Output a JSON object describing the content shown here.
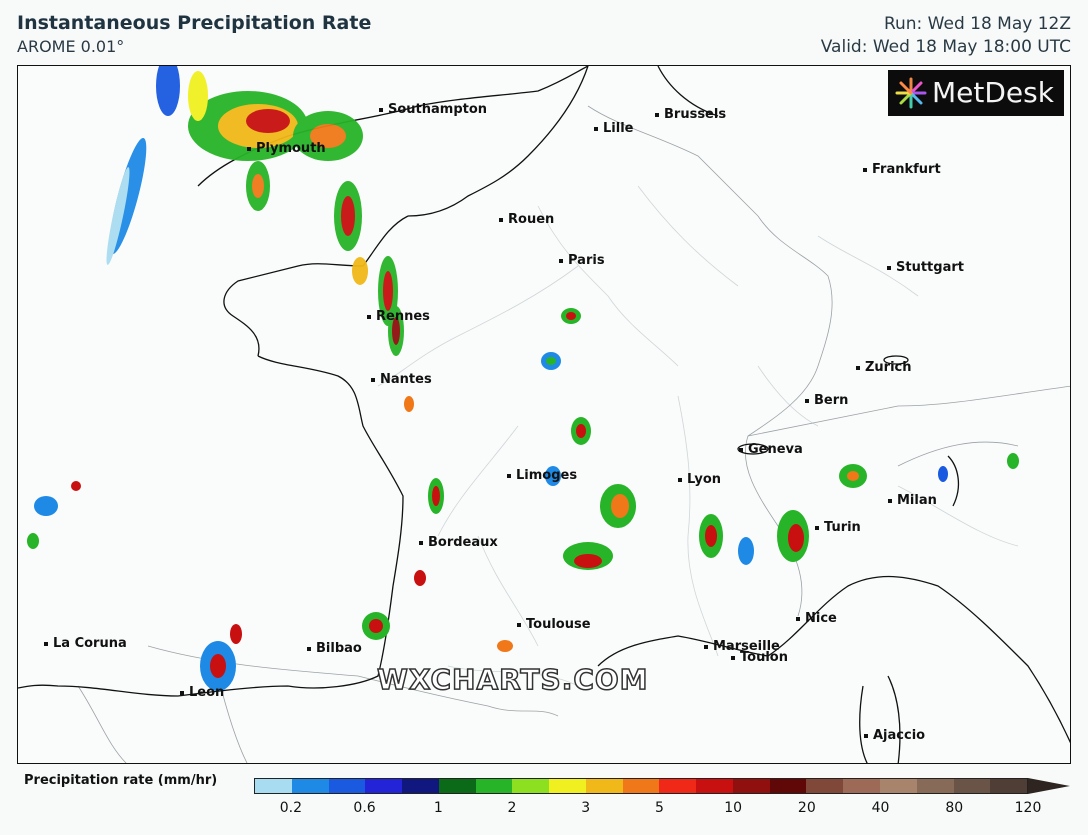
{
  "header": {
    "title": "Instantaneous Precipitation Rate",
    "model": "AROME 0.01°",
    "run": "Run: Wed 18 May 12Z",
    "valid": "Valid: Wed 18 May 18:00 UTC"
  },
  "logo": {
    "text": "MetDesk"
  },
  "watermark": "WXCHARTS.COM",
  "cities": [
    {
      "name": "Southampton"
    },
    {
      "name": "Brussels"
    },
    {
      "name": "Lille"
    },
    {
      "name": "Plymouth"
    },
    {
      "name": "Frankfurt"
    },
    {
      "name": "Rouen"
    },
    {
      "name": "Paris"
    },
    {
      "name": "Stuttgart"
    },
    {
      "name": "Rennes"
    },
    {
      "name": "Zurich"
    },
    {
      "name": "Nantes"
    },
    {
      "name": "Bern"
    },
    {
      "name": "Geneva"
    },
    {
      "name": "Limoges"
    },
    {
      "name": "Lyon"
    },
    {
      "name": "Milan"
    },
    {
      "name": "Turin"
    },
    {
      "name": "Bordeaux"
    },
    {
      "name": "Toulouse"
    },
    {
      "name": "Nice"
    },
    {
      "name": "La Coruna"
    },
    {
      "name": "Bilbao"
    },
    {
      "name": "Marseille"
    },
    {
      "name": "Toulon"
    },
    {
      "name": "Leon"
    },
    {
      "name": "Ajaccio"
    }
  ],
  "legend": {
    "title": "Precipitation rate (mm/hr)",
    "colors": [
      "#a8dcf0",
      "#1e8ae6",
      "#1a5ae0",
      "#2323d8",
      "#101880",
      "#0a6a18",
      "#28b428",
      "#8ce020",
      "#f0f020",
      "#f0b818",
      "#f07818",
      "#f02818",
      "#c81010",
      "#901010",
      "#600808",
      "#804838",
      "#9c6a56",
      "#a8846c",
      "#886a58",
      "#6a5448",
      "#4e3e36"
    ],
    "ticks": [
      "0.2",
      "0.6",
      "1",
      "2",
      "3",
      "5",
      "10",
      "20",
      "40",
      "80",
      "120"
    ]
  }
}
